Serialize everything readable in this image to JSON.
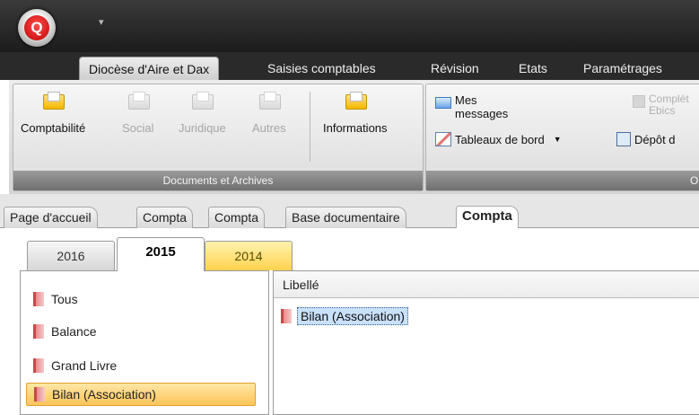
{
  "app": {
    "orb_letter": "Q",
    "qat_glyph": "▾"
  },
  "ribbon_tabs": [
    {
      "label": "Diocèse d'Aire et Dax",
      "active": true
    },
    {
      "label": "Saisies comptables"
    },
    {
      "label": "Révision"
    },
    {
      "label": "Etats"
    },
    {
      "label": "Paramétrages"
    }
  ],
  "ribbon": {
    "documents_group": {
      "label": "Documents et Archives",
      "buttons": [
        "Comptabilité",
        "Social",
        "Juridique",
        "Autres",
        "Informations"
      ]
    },
    "second_group": {
      "label": "Ou",
      "mes_messages_line1": "Mes",
      "mes_messages_line2": "messages",
      "completer_line1": "Complét",
      "completer_line2": "Ebics",
      "tableaux": "Tableaux de bord",
      "depot": "Dépôt d"
    }
  },
  "doc_tabs": [
    "Page d'accueil",
    "Compta",
    "Compta",
    "Base documentaire",
    "Compta"
  ],
  "year_tabs": [
    "2016",
    "2015",
    "2014"
  ],
  "left_list": [
    "Tous",
    "Balance",
    "Grand Livre",
    "Bilan (Association)"
  ],
  "grid": {
    "header": "Libellé",
    "rows": [
      "Bilan (Association)"
    ]
  },
  "colors": {
    "accent_yellow": "#ffc55a",
    "selection_blue": "#c9e1fb",
    "title_bar": "#2a2a2a"
  }
}
